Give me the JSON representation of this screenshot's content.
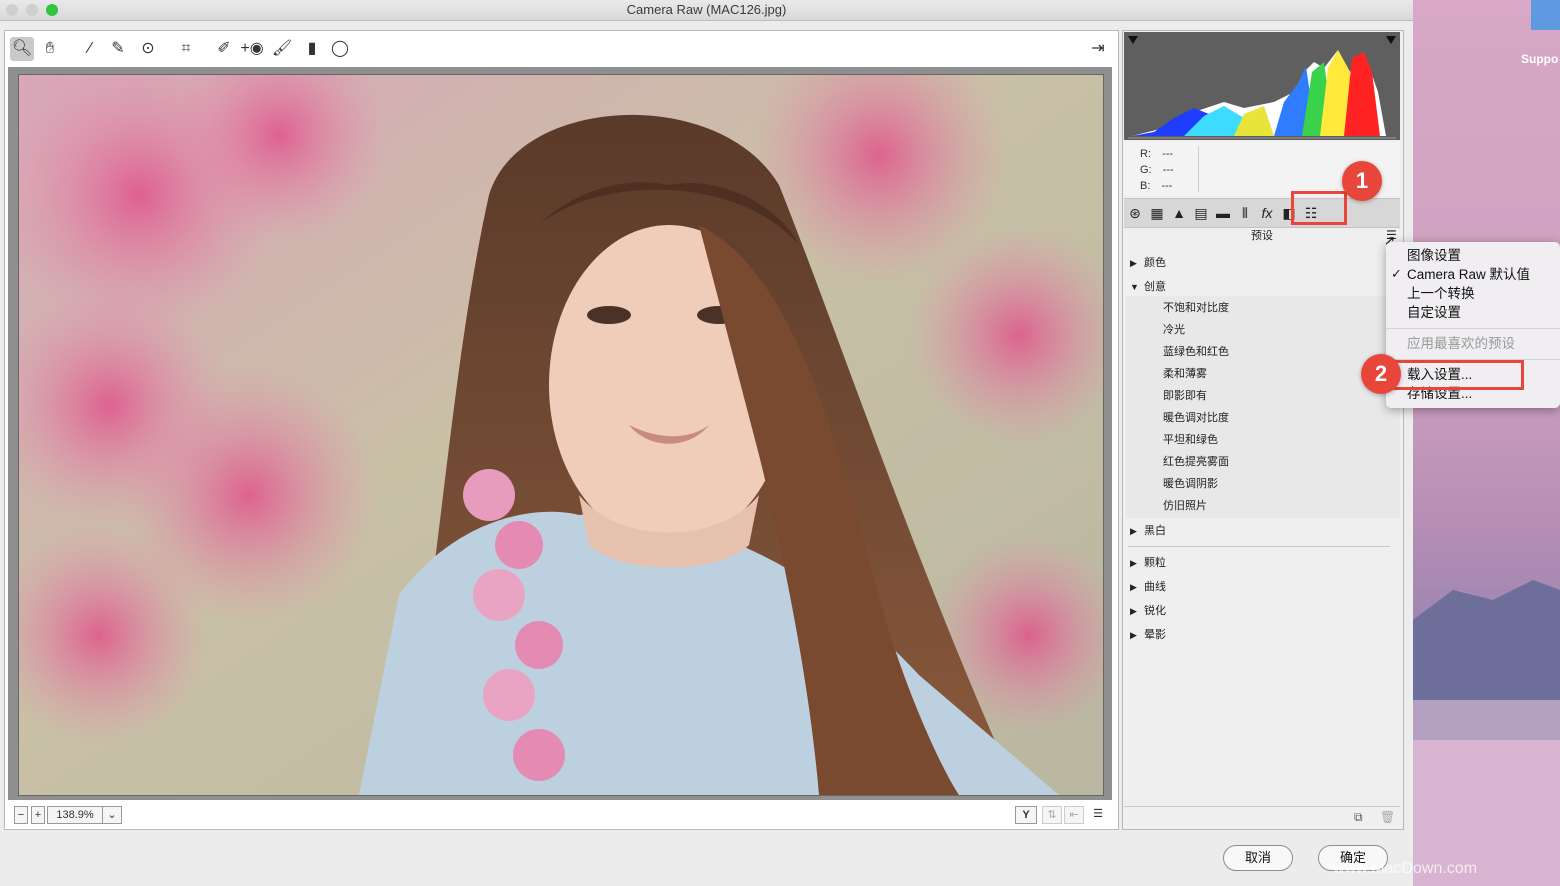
{
  "window": {
    "title": "Camera Raw (MAC126.jpg)"
  },
  "colors": {
    "accent_red": "#e8463b",
    "traffic_close": "#cfcfcf",
    "traffic_min": "#cfcfcf",
    "traffic_max": "#2fc540"
  },
  "toolbar": {
    "tools": [
      "zoom-tool",
      "hand-tool",
      "white-balance-tool",
      "color-sampler-tool",
      "targeted-adjustment-tool",
      "crop-tool",
      "spot-removal-tool",
      "red-eye-tool",
      "adjustment-brush-tool",
      "graduated-filter-tool",
      "radial-filter-tool"
    ],
    "open_in_photoshop_icon": "export-icon"
  },
  "status": {
    "zoom_value": "138.9%",
    "zoom_out_label": "−",
    "zoom_in_label": "+",
    "view_toggle_label": "Y"
  },
  "histogram": {
    "r_label": "R:",
    "r_value": "---",
    "g_label": "G:",
    "g_value": "---",
    "b_label": "B:",
    "b_value": "---"
  },
  "panel": {
    "tabs": [
      "basic",
      "tone-curve",
      "detail",
      "hsl",
      "split-toning",
      "lens-corrections",
      "effects",
      "camera-calibration",
      "presets"
    ],
    "preset_header": "预设",
    "groups": [
      {
        "label": "颜色",
        "expanded": false
      },
      {
        "label": "创意",
        "expanded": true
      },
      {
        "label": "黑白",
        "expanded": false
      },
      {
        "label": "颗粒",
        "expanded": false
      },
      {
        "label": "曲线",
        "expanded": false
      },
      {
        "label": "锐化",
        "expanded": false
      },
      {
        "label": "晕影",
        "expanded": false
      }
    ],
    "creative_items": [
      "不饱和对比度",
      "冷光",
      "蓝绿色和红色",
      "柔和薄雾",
      "即影即有",
      "暖色调对比度",
      "平坦和绿色",
      "红色提亮雾面",
      "暖色调阴影",
      "仿旧照片"
    ]
  },
  "menu": {
    "items": [
      {
        "label": "图像设置",
        "checked": false,
        "disabled": false
      },
      {
        "label": "Camera Raw 默认值",
        "checked": true,
        "disabled": false
      },
      {
        "label": "上一个转换",
        "checked": false,
        "disabled": false
      },
      {
        "label": "自定设置",
        "checked": false,
        "disabled": false
      },
      {
        "label": "应用最喜欢的预设",
        "checked": false,
        "disabled": true
      },
      {
        "label": "载入设置...",
        "checked": false,
        "disabled": false
      },
      {
        "label": "存储设置...",
        "checked": false,
        "disabled": false
      }
    ],
    "check_mark": "✓"
  },
  "annotations": {
    "badge1": "1",
    "badge2": "2"
  },
  "buttons": {
    "cancel": "取消",
    "ok": "确定"
  },
  "desktop": {
    "icon_label": "Suppo",
    "watermark": "www.MacDown.com"
  }
}
